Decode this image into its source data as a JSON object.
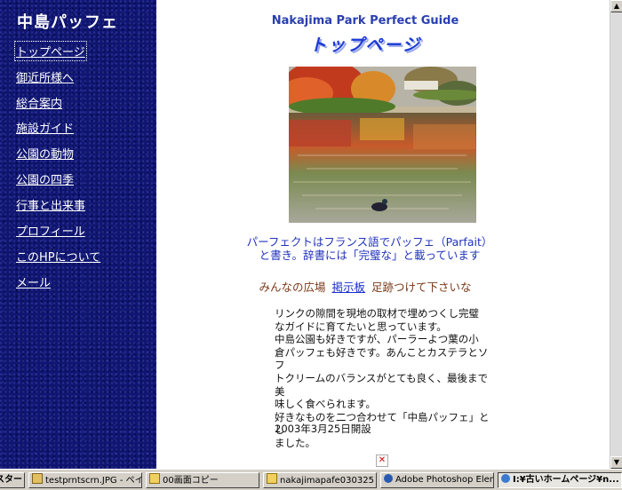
{
  "sidebar": {
    "title": "中島パッフェ",
    "nav": [
      {
        "label": "トップページ"
      },
      {
        "label": "御近所様へ"
      },
      {
        "label": "総合案内"
      },
      {
        "label": "施設ガイド"
      },
      {
        "label": "公園の動物"
      },
      {
        "label": "公園の四季"
      },
      {
        "label": "行事と出来事"
      },
      {
        "label": "プロフィール"
      },
      {
        "label": "このHPについて"
      },
      {
        "label": "メール"
      }
    ]
  },
  "main": {
    "guide_heading": "Nakajima Park Perfect Guide",
    "page_title": "トップページ",
    "photo_icon": "autumn-pond-photo",
    "caption_line1": "パーフェクトはフランス語でパッフェ（Parfait）",
    "caption_line2": "と書き。辞書には「完璧な」と載っています",
    "forum_prefix": "みんなの広場",
    "forum_link": "掲示板",
    "forum_suffix": "足跡つけて下さいな",
    "intro_lines": [
      "リンクの隙間を現地の取材で埋めつくし完璧",
      "なガイドに育てたいと思っています。",
      "中島公園も好きですが、パーラーよつ葉の小",
      "倉パッフェも好きです。あんことカステラとソフ",
      "トクリームのバランスがとても良く、最後まで美",
      "味しく食べられます。",
      "好きなものを二つ合わせて「中島パッフェ」とし",
      "ました。"
    ],
    "open_date": "2003年3月25日開設",
    "broken_image_glyph": "✕"
  },
  "taskbar": {
    "start": "スタート",
    "items": [
      {
        "label": "testprntscrn.JPG - ペイ..."
      },
      {
        "label": "00画面コピー"
      },
      {
        "label": "nakajimapafe030325"
      },
      {
        "label": "Adobe Photoshop Eleme..."
      },
      {
        "label": "I:¥古いホームページ¥n..."
      }
    ]
  },
  "colors": {
    "sidebar_bg": "#0f1570",
    "link_blue": "#1a2ed0",
    "heading_blue": "#2a3fb0",
    "forum_brown": "#7a3a1a"
  }
}
